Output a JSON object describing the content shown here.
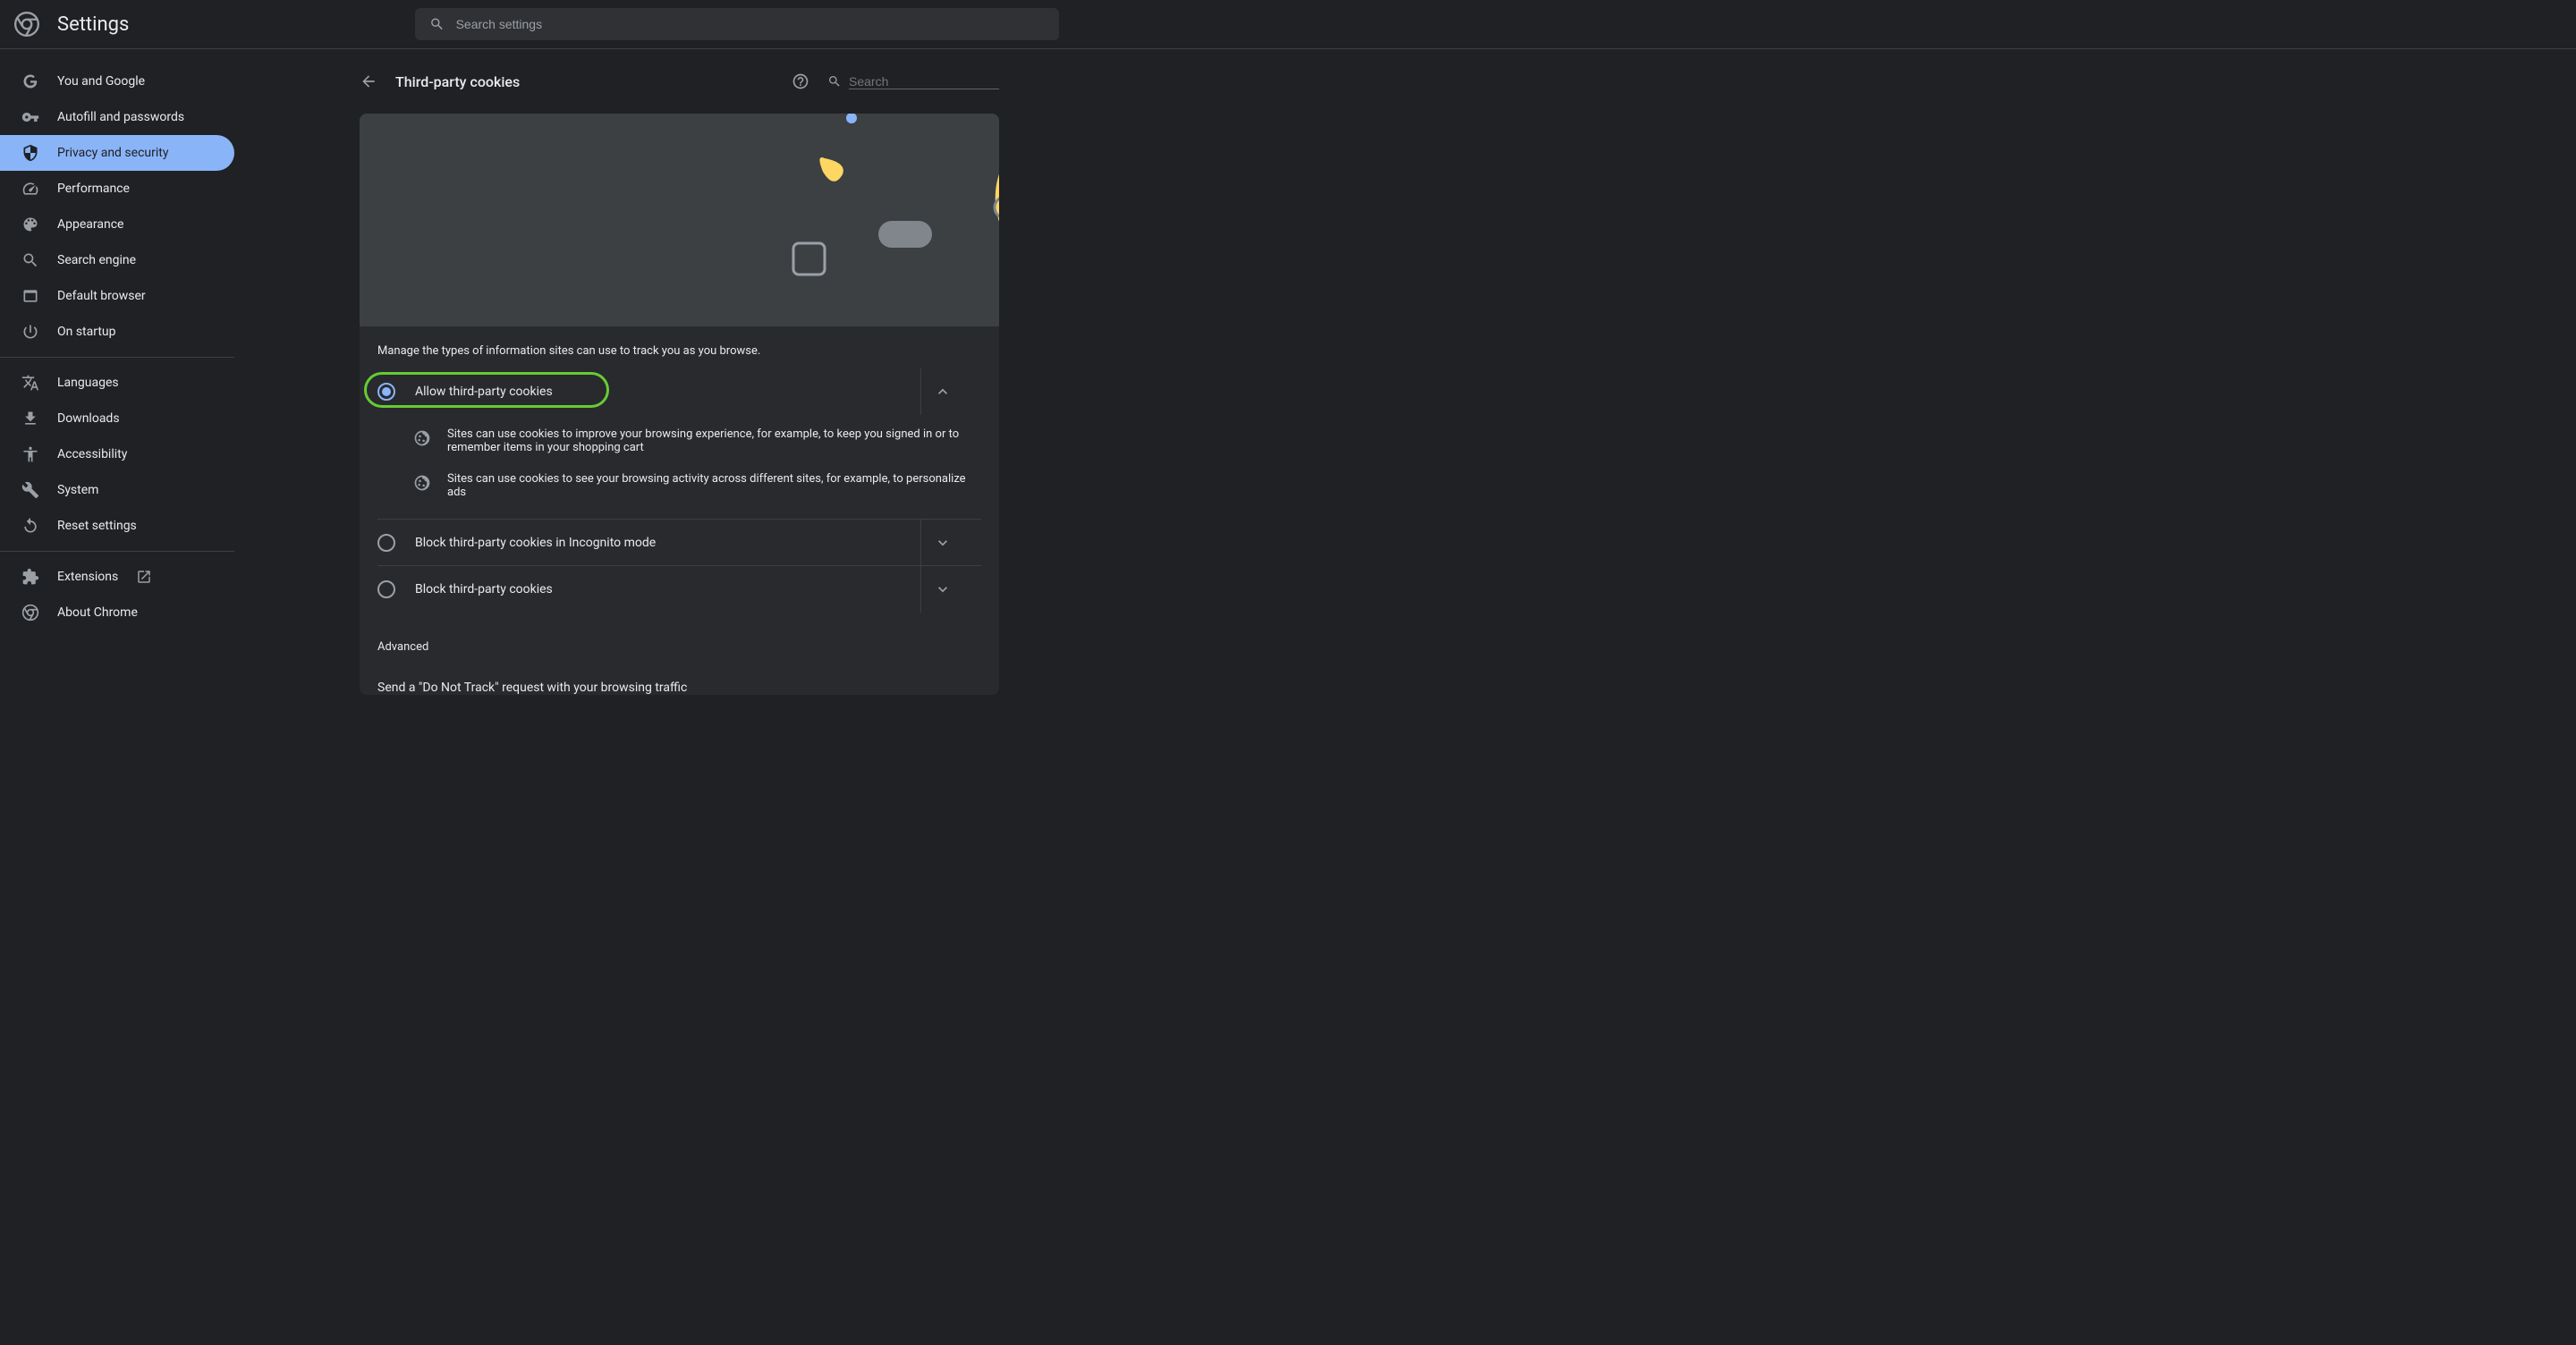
{
  "app_title": "Settings",
  "search_placeholder": "Search settings",
  "sidebar": {
    "items": [
      {
        "id": "you-google",
        "label": "You and Google"
      },
      {
        "id": "autofill",
        "label": "Autofill and passwords"
      },
      {
        "id": "privacy",
        "label": "Privacy and security",
        "active": true
      },
      {
        "id": "performance",
        "label": "Performance"
      },
      {
        "id": "appearance",
        "label": "Appearance"
      },
      {
        "id": "search-engine",
        "label": "Search engine"
      },
      {
        "id": "default-browser",
        "label": "Default browser"
      },
      {
        "id": "on-startup",
        "label": "On startup"
      }
    ],
    "items2": [
      {
        "id": "languages",
        "label": "Languages"
      },
      {
        "id": "downloads",
        "label": "Downloads"
      },
      {
        "id": "accessibility",
        "label": "Accessibility"
      },
      {
        "id": "system",
        "label": "System"
      },
      {
        "id": "reset",
        "label": "Reset settings"
      }
    ],
    "items3": [
      {
        "id": "extensions",
        "label": "Extensions",
        "external": true
      },
      {
        "id": "about",
        "label": "About Chrome"
      }
    ]
  },
  "panel": {
    "title": "Third-party cookies",
    "search_placeholder": "Search",
    "manage_text": "Manage the types of information sites can use to track you as you browse.",
    "options": [
      {
        "label": "Allow third-party cookies",
        "selected": true,
        "expanded": true
      },
      {
        "label": "Block third-party cookies in Incognito mode",
        "selected": false,
        "expanded": false
      },
      {
        "label": "Block third-party cookies",
        "selected": false,
        "expanded": false
      }
    ],
    "details": [
      "Sites can use cookies to improve your browsing experience, for example, to keep you signed in or to remember items in your shopping cart",
      "Sites can use cookies to see your browsing activity across different sites, for example, to personalize ads"
    ],
    "advanced_label": "Advanced",
    "dnt_title": "Send a \"Do Not Track\" request with your browsing traffic"
  }
}
